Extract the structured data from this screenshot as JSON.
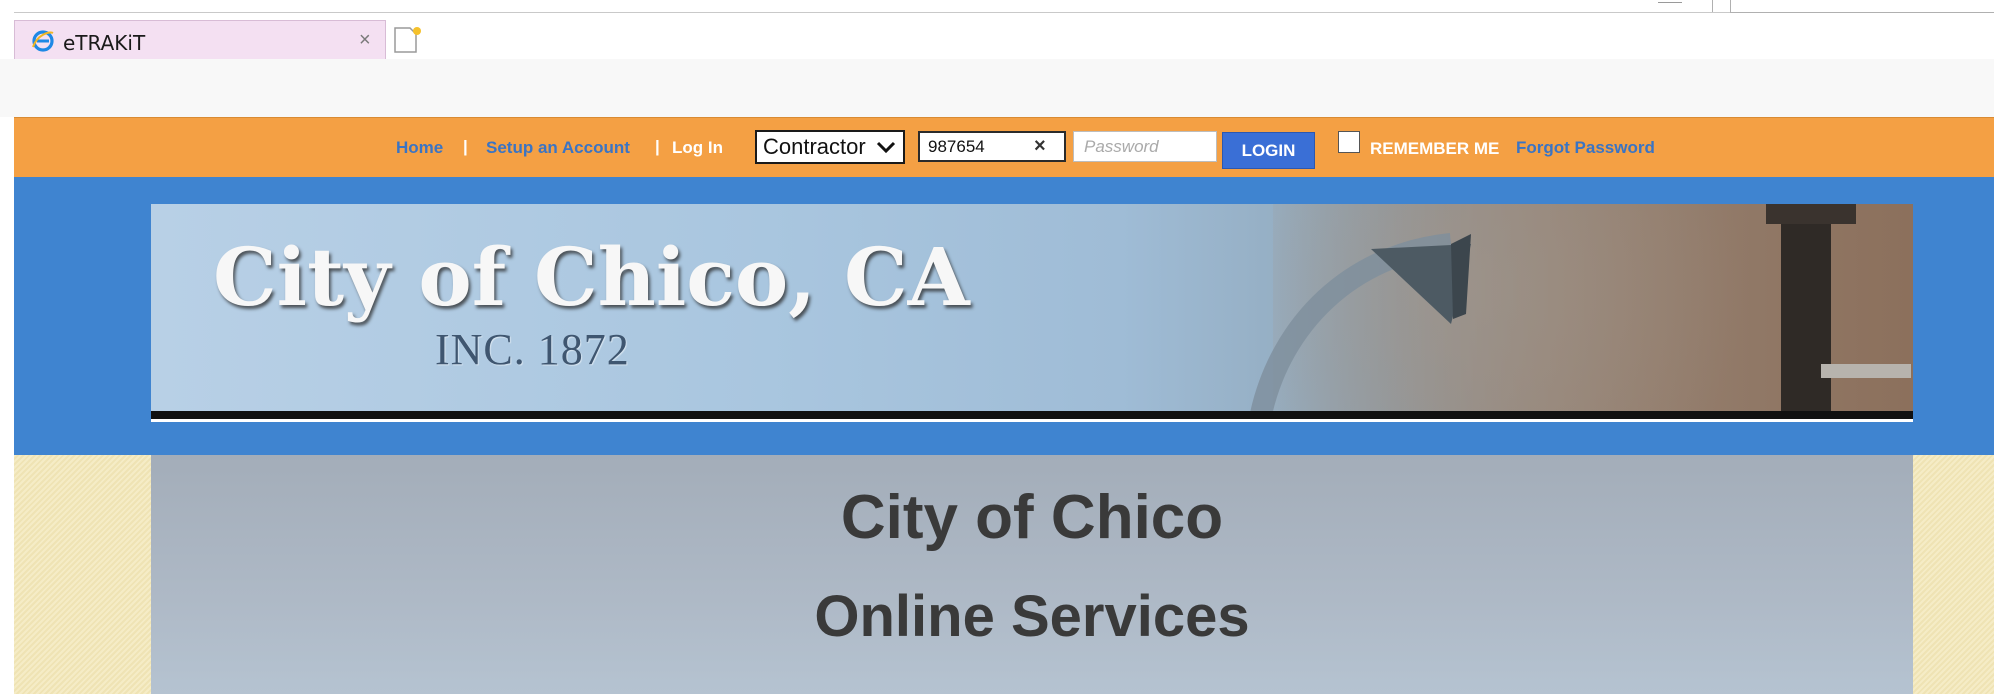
{
  "browser": {
    "tab_title": "eTRAKiT",
    "tab_close": "×"
  },
  "nav": {
    "home": "Home",
    "sep1": "|",
    "setup_account": "Setup an Account",
    "sep2": "|",
    "login_label": "Log In",
    "user_type": "Contractor",
    "username_value": "987654",
    "clear_symbol": "×",
    "password_placeholder": "Password",
    "login_button": "LOGIN",
    "remember_me": "REMEMBER ME",
    "forgot_password": "Forgot Password"
  },
  "banner": {
    "title": "City of Chico, CA",
    "subtitle": "INC. 1872"
  },
  "content": {
    "title": "City of Chico",
    "subtitle": "Online Services"
  },
  "colors": {
    "nav_bar": "#f4a044",
    "header_band": "#3f84d0",
    "login_button": "#3a6fd6",
    "nav_link": "#3a74c4"
  }
}
